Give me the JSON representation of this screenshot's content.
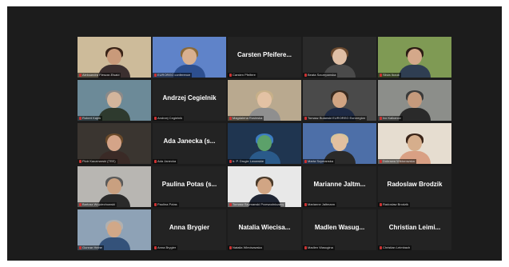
{
  "app": {
    "background": "#1c1c1c",
    "active_speaker_color": "#d9c36a"
  },
  "tiles": [
    {
      "kind": "video",
      "name_label": "Aleksandra Fleszar-Elsaid",
      "bg": "#cdbb9a",
      "skin": "#c99a7a",
      "hair": "#3a2418",
      "shirt": "#3b2f2f"
    },
    {
      "kind": "video",
      "name_label": "EUROREG conference",
      "bg": "#5f83c9",
      "skin": "#d8b090",
      "hair": "#8a6a3a",
      "shirt": "#2d4f8f"
    },
    {
      "kind": "name",
      "display_name": "Carsten Pfeifere...",
      "name_label": "Carsten Pfeifere"
    },
    {
      "kind": "video",
      "name_label": "Beata Szczepanska",
      "bg": "#2a2a2a",
      "skin": "#e0bfa5",
      "hair": "#6b4a2f",
      "shirt": "#4a4a4a"
    },
    {
      "kind": "video",
      "name_label": "Silvia Ilczuk",
      "bg": "#7f9a54",
      "skin": "#d4a88a",
      "hair": "#2b1c14",
      "shirt": "#2f3e52"
    },
    {
      "kind": "video",
      "active": true,
      "name_label": "Robert Kajek",
      "bg": "#6c8a98",
      "skin": "#d3b59c",
      "hair": "#8a8a8a",
      "shirt": "#2e3a2e"
    },
    {
      "kind": "name",
      "display_name": "Andrzej Cegielnik",
      "name_label": "Andrzej Cegielnik"
    },
    {
      "kind": "video",
      "name_label": "Magdalena Rosinska",
      "bg": "#b9a98f",
      "skin": "#e3c2a4",
      "hair": "#c7b089",
      "shirt": "#8f8f8f"
    },
    {
      "kind": "video",
      "name_label": "Tomasz Bulanski EUROREG Euroregion",
      "bg": "#4a4a4a",
      "skin": "#d2a583",
      "hair": "#3a2a1e",
      "shirt": "#1e2a44"
    },
    {
      "kind": "video",
      "name_label": "Ivo Kalkanov",
      "bg": "#8c8e8a",
      "skin": "#c59a7c",
      "hair": "#3a3a3a",
      "shirt": "#2a2a2a"
    },
    {
      "kind": "video",
      "name_label": "Piotr Kaczmarski (TEE)",
      "bg": "#3a3530",
      "skin": "#d4a488",
      "hair": "#6a4a2a",
      "shirt": "#3a2a26"
    },
    {
      "kind": "name",
      "display_name": "Ada Janecka (s...",
      "name_label": "Ada Janecka"
    },
    {
      "kind": "video",
      "name_label": "Ir. P. Drugie Lwowskie",
      "bg": "#1f3550",
      "skin": "#5ca16a",
      "hair": "#3d7dc2",
      "shirt": "#2a5a8a"
    },
    {
      "kind": "video",
      "name_label": "Marta Szymanska",
      "bg": "#4d6fa8",
      "skin": "#e2c0a0",
      "hair": "#d8c39a",
      "shirt": "#2a2a2a"
    },
    {
      "kind": "video",
      "name_label": "Dobrawa Wiktorowska",
      "bg": "#e6ddd0",
      "skin": "#d6ae8c",
      "hair": "#3a2418",
      "shirt": "#d9a084"
    },
    {
      "kind": "video",
      "name_label": "Bartosz Wojciechowski",
      "bg": "#b8b6b2",
      "skin": "#c9a080",
      "hair": "#5a5a5a",
      "shirt": "#2a2a2a"
    },
    {
      "kind": "name",
      "display_name": "Paulina Potas (s...",
      "name_label": "Paulina Potas"
    },
    {
      "kind": "video",
      "name_label": "Tomasz Szymanski Przewodniczacy",
      "bg": "#e8e8e8",
      "skin": "#d1a584",
      "hair": "#4a3a2a",
      "shirt": "#1f2533"
    },
    {
      "kind": "name",
      "display_name": "Marianne Jaltm...",
      "name_label": "Marianne Jaltmann"
    },
    {
      "kind": "name",
      "display_name": "Radoslaw Brodzik",
      "name_label": "Radoslaw Brodzik"
    },
    {
      "kind": "video",
      "name_label": "Gunnar Heine",
      "bg": "#8ea2b6",
      "skin": "#d1a888",
      "hair": "#b0b0b0",
      "shirt": "#34527a"
    },
    {
      "kind": "name",
      "display_name": "Anna Brygier",
      "name_label": "Anna Brygier"
    },
    {
      "kind": "name",
      "display_name": "Natalia Wiecisa...",
      "name_label": "Natalia Wiecisawska"
    },
    {
      "kind": "name",
      "display_name": "Madlen Wasug...",
      "name_label": "Madlen Wasugina"
    },
    {
      "kind": "name",
      "display_name": "Christian Leimi...",
      "name_label": "Christian Leimbach"
    }
  ]
}
